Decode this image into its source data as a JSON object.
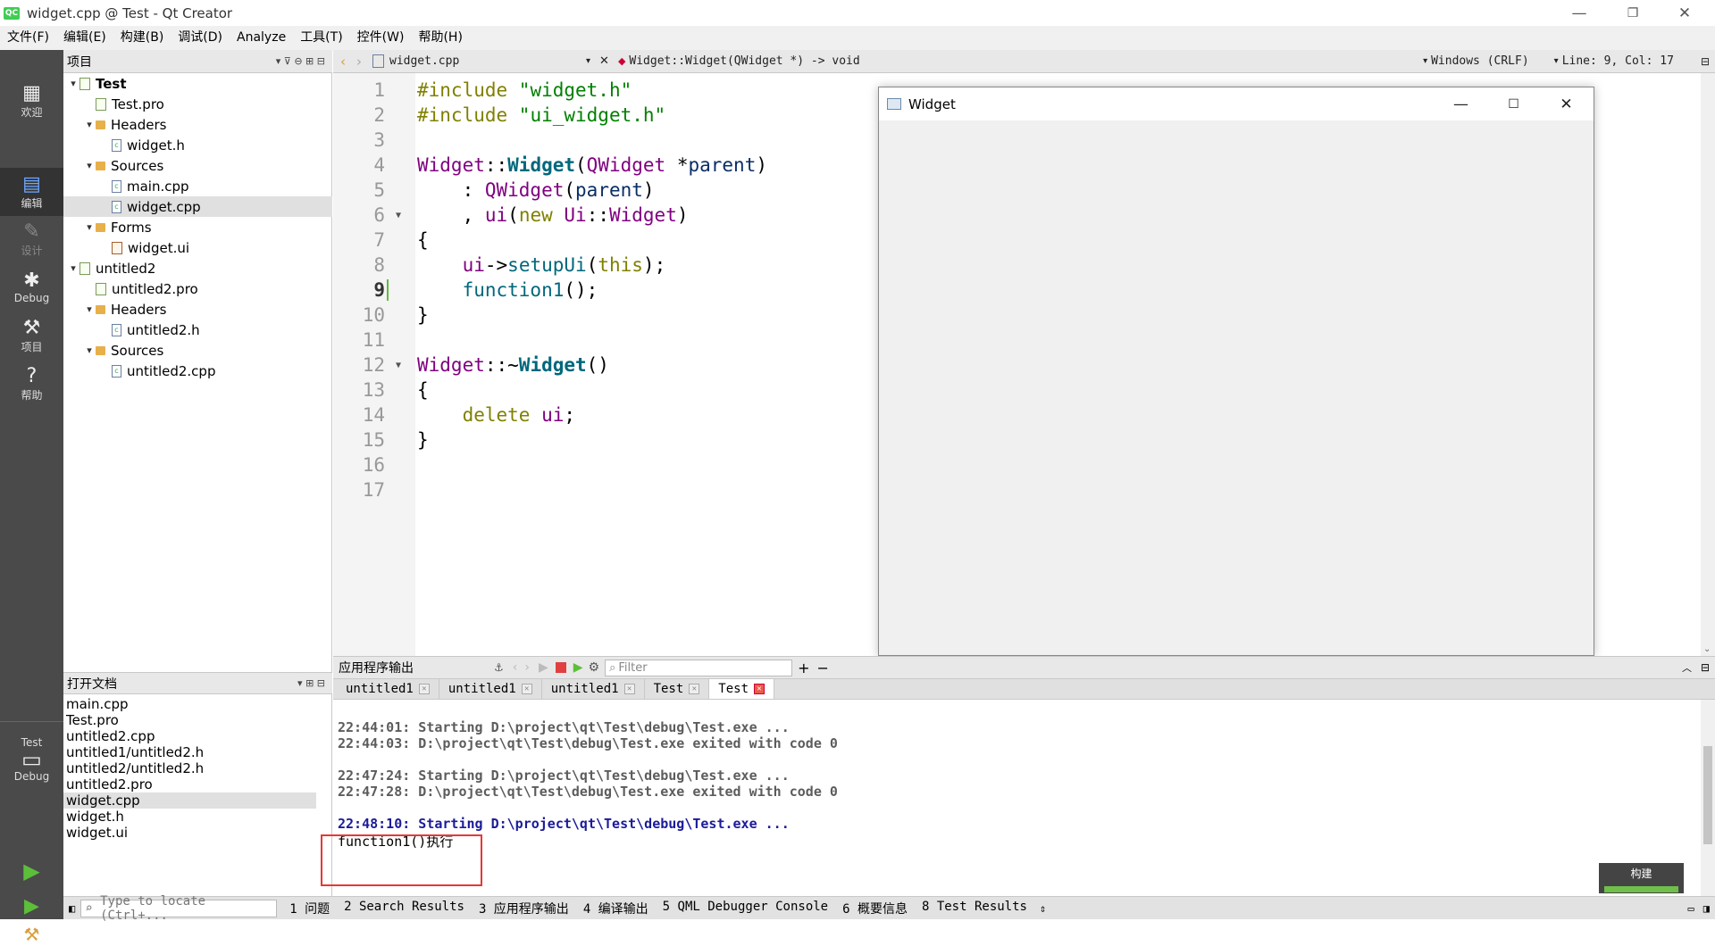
{
  "window": {
    "title": "widget.cpp @ Test - Qt Creator",
    "logo_text": "QC"
  },
  "menu": [
    "文件(F)",
    "编辑(E)",
    "构建(B)",
    "调试(D)",
    "Analyze",
    "工具(T)",
    "控件(W)",
    "帮助(H)"
  ],
  "modes": [
    {
      "label": "欢迎",
      "icon": "grid-icon"
    },
    {
      "label": "编辑",
      "icon": "edit-icon"
    },
    {
      "label": "设计",
      "icon": "design-icon"
    },
    {
      "label": "Debug",
      "icon": "bug-icon"
    },
    {
      "label": "项目",
      "icon": "wrench-icon"
    },
    {
      "label": "帮助",
      "icon": "help-icon"
    }
  ],
  "kit": {
    "project": "Test",
    "config": "Debug"
  },
  "project_pane": {
    "title": "项目"
  },
  "tree": [
    {
      "label": "Test",
      "level": 0,
      "arrow": "▾",
      "kind": "pro",
      "bold": true
    },
    {
      "label": "Test.pro",
      "level": 1,
      "arrow": "",
      "kind": "pro"
    },
    {
      "label": "Headers",
      "level": 1,
      "arrow": "▾",
      "kind": "folder"
    },
    {
      "label": "widget.h",
      "level": 2,
      "arrow": "",
      "kind": "file"
    },
    {
      "label": "Sources",
      "level": 1,
      "arrow": "▾",
      "kind": "folder"
    },
    {
      "label": "main.cpp",
      "level": 2,
      "arrow": "",
      "kind": "file"
    },
    {
      "label": "widget.cpp",
      "level": 2,
      "arrow": "",
      "kind": "file",
      "selected": true
    },
    {
      "label": "Forms",
      "level": 1,
      "arrow": "▾",
      "kind": "folder"
    },
    {
      "label": "widget.ui",
      "level": 2,
      "arrow": "",
      "kind": "ui"
    },
    {
      "label": "untitled2",
      "level": 0,
      "arrow": "▾",
      "kind": "pro"
    },
    {
      "label": "untitled2.pro",
      "level": 1,
      "arrow": "",
      "kind": "pro"
    },
    {
      "label": "Headers",
      "level": 1,
      "arrow": "▾",
      "kind": "folder"
    },
    {
      "label": "untitled2.h",
      "level": 2,
      "arrow": "",
      "kind": "file"
    },
    {
      "label": "Sources",
      "level": 1,
      "arrow": "▾",
      "kind": "folder"
    },
    {
      "label": "untitled2.cpp",
      "level": 2,
      "arrow": "",
      "kind": "file"
    }
  ],
  "open_docs": {
    "title": "打开文档",
    "items": [
      "main.cpp",
      "Test.pro",
      "untitled2.cpp",
      "untitled1/untitled2.h",
      "untitled2/untitled2.h",
      "untitled2.pro",
      "widget.cpp",
      "widget.h",
      "widget.ui"
    ],
    "selected": 6
  },
  "editor": {
    "file": "widget.cpp",
    "symbol": "Widget::Widget(QWidget *) -> void",
    "line_ending": "Windows (CRLF)",
    "position": "Line: 9, Col: 17",
    "current_line": 9
  },
  "code_lines": [
    [
      [
        "kw",
        "#include "
      ],
      [
        "str",
        "\"widget.h\""
      ]
    ],
    [
      [
        "kw",
        "#include "
      ],
      [
        "str",
        "\"ui_widget.h\""
      ]
    ],
    [],
    [
      [
        "typ",
        "Widget"
      ],
      [
        "",
        "::"
      ],
      [
        "fn",
        "Widget"
      ],
      [
        "",
        "("
      ],
      [
        "typ",
        "QWidget"
      ],
      [
        "",
        " *"
      ],
      [
        "par",
        "parent"
      ],
      [
        "",
        ")"
      ]
    ],
    [
      [
        "",
        "    : "
      ],
      [
        "typ",
        "QWidget"
      ],
      [
        "",
        "("
      ],
      [
        "par",
        "parent"
      ],
      [
        "",
        ")"
      ]
    ],
    [
      [
        "",
        "    , "
      ],
      [
        "typ",
        "ui"
      ],
      [
        "",
        "("
      ],
      [
        "kw",
        "new "
      ],
      [
        "typ",
        "Ui"
      ],
      [
        "",
        "::"
      ],
      [
        "typ",
        "Widget"
      ],
      [
        "",
        ")"
      ]
    ],
    [
      [
        "",
        "{"
      ]
    ],
    [
      [
        "",
        "    "
      ],
      [
        "typ",
        "ui"
      ],
      [
        "",
        "->"
      ],
      [
        "fnc",
        "setupUi"
      ],
      [
        "",
        "("
      ],
      [
        "kw",
        "this"
      ],
      [
        "",
        ");"
      ]
    ],
    [
      [
        "",
        "    "
      ],
      [
        "fnc",
        "function1"
      ],
      [
        "",
        "();"
      ]
    ],
    [
      [
        "",
        "}"
      ]
    ],
    [],
    [
      [
        "typ",
        "Widget"
      ],
      [
        "",
        "::~"
      ],
      [
        "fn",
        "Widget"
      ],
      [
        "",
        "()"
      ]
    ],
    [
      [
        "",
        "{"
      ]
    ],
    [
      [
        "",
        "    "
      ],
      [
        "kw",
        "delete "
      ],
      [
        "typ",
        "ui"
      ],
      [
        "",
        ";"
      ]
    ],
    [
      [
        "",
        "}"
      ]
    ],
    [],
    []
  ],
  "folds": [
    6,
    12
  ],
  "app_window": {
    "title": "Widget"
  },
  "output_pane": {
    "title": "应用程序输出",
    "filter_placeholder": "Filter",
    "tabs": [
      "untitled1",
      "untitled1",
      "untitled1",
      "Test",
      "Test"
    ],
    "active_tab": 4
  },
  "output_lines": [
    {
      "text": "22:44:01: Starting D:\\project\\qt\\Test\\debug\\Test.exe ...",
      "style": "gray"
    },
    {
      "text": "22:44:03: D:\\project\\qt\\Test\\debug\\Test.exe exited with code 0",
      "style": "gray"
    },
    {
      "text": "",
      "style": "gray"
    },
    {
      "text": "22:47:24: Starting D:\\project\\qt\\Test\\debug\\Test.exe ...",
      "style": "gray"
    },
    {
      "text": "22:47:28: D:\\project\\qt\\Test\\debug\\Test.exe exited with code 0",
      "style": "gray"
    },
    {
      "text": "",
      "style": "gray"
    },
    {
      "text": "22:48:10: Starting D:\\project\\qt\\Test\\debug\\Test.exe ...",
      "style": "blue"
    },
    {
      "text": "function1()执行",
      "style": "plain"
    }
  ],
  "build_progress": {
    "label": "构建",
    "fraction": 1.0
  },
  "status": {
    "locate_placeholder": "Type to locate (Ctrl+...",
    "panes": [
      "1 问题",
      "2 Search Results",
      "3 应用程序输出",
      "4 编译输出",
      "5 QML Debugger Console",
      "6 概要信息",
      "8 Test Results"
    ]
  }
}
